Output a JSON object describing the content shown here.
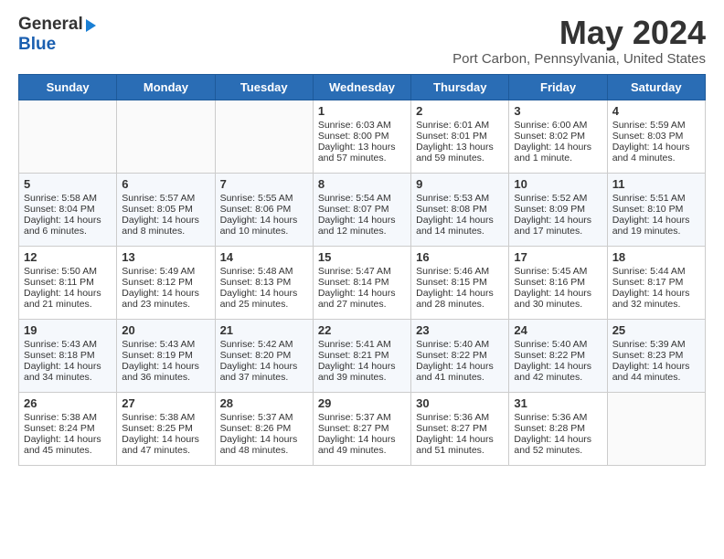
{
  "header": {
    "logo_line1": "General",
    "logo_line2": "Blue",
    "month": "May 2024",
    "location": "Port Carbon, Pennsylvania, United States"
  },
  "days_of_week": [
    "Sunday",
    "Monday",
    "Tuesday",
    "Wednesday",
    "Thursday",
    "Friday",
    "Saturday"
  ],
  "weeks": [
    [
      {
        "day": "",
        "empty": true
      },
      {
        "day": "",
        "empty": true
      },
      {
        "day": "",
        "empty": true
      },
      {
        "day": "1",
        "sunrise": "Sunrise: 6:03 AM",
        "sunset": "Sunset: 8:00 PM",
        "daylight": "Daylight: 13 hours and 57 minutes."
      },
      {
        "day": "2",
        "sunrise": "Sunrise: 6:01 AM",
        "sunset": "Sunset: 8:01 PM",
        "daylight": "Daylight: 13 hours and 59 minutes."
      },
      {
        "day": "3",
        "sunrise": "Sunrise: 6:00 AM",
        "sunset": "Sunset: 8:02 PM",
        "daylight": "Daylight: 14 hours and 1 minute."
      },
      {
        "day": "4",
        "sunrise": "Sunrise: 5:59 AM",
        "sunset": "Sunset: 8:03 PM",
        "daylight": "Daylight: 14 hours and 4 minutes."
      }
    ],
    [
      {
        "day": "5",
        "sunrise": "Sunrise: 5:58 AM",
        "sunset": "Sunset: 8:04 PM",
        "daylight": "Daylight: 14 hours and 6 minutes."
      },
      {
        "day": "6",
        "sunrise": "Sunrise: 5:57 AM",
        "sunset": "Sunset: 8:05 PM",
        "daylight": "Daylight: 14 hours and 8 minutes."
      },
      {
        "day": "7",
        "sunrise": "Sunrise: 5:55 AM",
        "sunset": "Sunset: 8:06 PM",
        "daylight": "Daylight: 14 hours and 10 minutes."
      },
      {
        "day": "8",
        "sunrise": "Sunrise: 5:54 AM",
        "sunset": "Sunset: 8:07 PM",
        "daylight": "Daylight: 14 hours and 12 minutes."
      },
      {
        "day": "9",
        "sunrise": "Sunrise: 5:53 AM",
        "sunset": "Sunset: 8:08 PM",
        "daylight": "Daylight: 14 hours and 14 minutes."
      },
      {
        "day": "10",
        "sunrise": "Sunrise: 5:52 AM",
        "sunset": "Sunset: 8:09 PM",
        "daylight": "Daylight: 14 hours and 17 minutes."
      },
      {
        "day": "11",
        "sunrise": "Sunrise: 5:51 AM",
        "sunset": "Sunset: 8:10 PM",
        "daylight": "Daylight: 14 hours and 19 minutes."
      }
    ],
    [
      {
        "day": "12",
        "sunrise": "Sunrise: 5:50 AM",
        "sunset": "Sunset: 8:11 PM",
        "daylight": "Daylight: 14 hours and 21 minutes."
      },
      {
        "day": "13",
        "sunrise": "Sunrise: 5:49 AM",
        "sunset": "Sunset: 8:12 PM",
        "daylight": "Daylight: 14 hours and 23 minutes."
      },
      {
        "day": "14",
        "sunrise": "Sunrise: 5:48 AM",
        "sunset": "Sunset: 8:13 PM",
        "daylight": "Daylight: 14 hours and 25 minutes."
      },
      {
        "day": "15",
        "sunrise": "Sunrise: 5:47 AM",
        "sunset": "Sunset: 8:14 PM",
        "daylight": "Daylight: 14 hours and 27 minutes."
      },
      {
        "day": "16",
        "sunrise": "Sunrise: 5:46 AM",
        "sunset": "Sunset: 8:15 PM",
        "daylight": "Daylight: 14 hours and 28 minutes."
      },
      {
        "day": "17",
        "sunrise": "Sunrise: 5:45 AM",
        "sunset": "Sunset: 8:16 PM",
        "daylight": "Daylight: 14 hours and 30 minutes."
      },
      {
        "day": "18",
        "sunrise": "Sunrise: 5:44 AM",
        "sunset": "Sunset: 8:17 PM",
        "daylight": "Daylight: 14 hours and 32 minutes."
      }
    ],
    [
      {
        "day": "19",
        "sunrise": "Sunrise: 5:43 AM",
        "sunset": "Sunset: 8:18 PM",
        "daylight": "Daylight: 14 hours and 34 minutes."
      },
      {
        "day": "20",
        "sunrise": "Sunrise: 5:43 AM",
        "sunset": "Sunset: 8:19 PM",
        "daylight": "Daylight: 14 hours and 36 minutes."
      },
      {
        "day": "21",
        "sunrise": "Sunrise: 5:42 AM",
        "sunset": "Sunset: 8:20 PM",
        "daylight": "Daylight: 14 hours and 37 minutes."
      },
      {
        "day": "22",
        "sunrise": "Sunrise: 5:41 AM",
        "sunset": "Sunset: 8:21 PM",
        "daylight": "Daylight: 14 hours and 39 minutes."
      },
      {
        "day": "23",
        "sunrise": "Sunrise: 5:40 AM",
        "sunset": "Sunset: 8:22 PM",
        "daylight": "Daylight: 14 hours and 41 minutes."
      },
      {
        "day": "24",
        "sunrise": "Sunrise: 5:40 AM",
        "sunset": "Sunset: 8:22 PM",
        "daylight": "Daylight: 14 hours and 42 minutes."
      },
      {
        "day": "25",
        "sunrise": "Sunrise: 5:39 AM",
        "sunset": "Sunset: 8:23 PM",
        "daylight": "Daylight: 14 hours and 44 minutes."
      }
    ],
    [
      {
        "day": "26",
        "sunrise": "Sunrise: 5:38 AM",
        "sunset": "Sunset: 8:24 PM",
        "daylight": "Daylight: 14 hours and 45 minutes."
      },
      {
        "day": "27",
        "sunrise": "Sunrise: 5:38 AM",
        "sunset": "Sunset: 8:25 PM",
        "daylight": "Daylight: 14 hours and 47 minutes."
      },
      {
        "day": "28",
        "sunrise": "Sunrise: 5:37 AM",
        "sunset": "Sunset: 8:26 PM",
        "daylight": "Daylight: 14 hours and 48 minutes."
      },
      {
        "day": "29",
        "sunrise": "Sunrise: 5:37 AM",
        "sunset": "Sunset: 8:27 PM",
        "daylight": "Daylight: 14 hours and 49 minutes."
      },
      {
        "day": "30",
        "sunrise": "Sunrise: 5:36 AM",
        "sunset": "Sunset: 8:27 PM",
        "daylight": "Daylight: 14 hours and 51 minutes."
      },
      {
        "day": "31",
        "sunrise": "Sunrise: 5:36 AM",
        "sunset": "Sunset: 8:28 PM",
        "daylight": "Daylight: 14 hours and 52 minutes."
      },
      {
        "day": "",
        "empty": true
      }
    ]
  ]
}
